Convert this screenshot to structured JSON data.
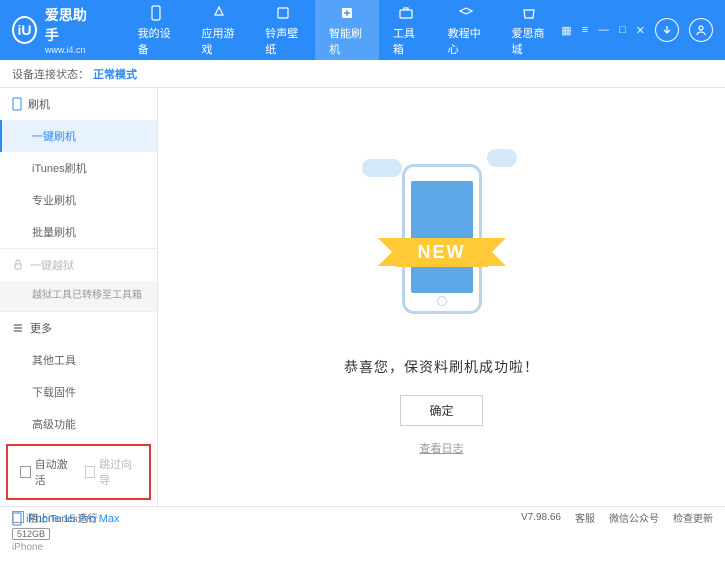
{
  "header": {
    "logo_char": "iU",
    "title": "爱思助手",
    "url": "www.i4.cn",
    "nav": [
      {
        "label": "我的设备"
      },
      {
        "label": "应用游戏"
      },
      {
        "label": "铃声壁纸"
      },
      {
        "label": "智能刷机"
      },
      {
        "label": "工具箱"
      },
      {
        "label": "教程中心"
      },
      {
        "label": "爱思商城"
      }
    ]
  },
  "status": {
    "label": "设备连接状态：",
    "mode": "正常模式"
  },
  "sidebar": {
    "section1": {
      "title": "刷机",
      "items": [
        "一键刷机",
        "iTunes刷机",
        "专业刷机",
        "批量刷机"
      ]
    },
    "section2": {
      "title": "一键越狱",
      "note": "越狱工具已转移至工具箱"
    },
    "section3": {
      "title": "更多",
      "items": [
        "其他工具",
        "下载固件",
        "高级功能"
      ]
    },
    "checkboxes": {
      "auto_activate": "自动激活",
      "skip_setup": "跳过向导"
    },
    "device": {
      "name": "iPhone 15 Pro Max",
      "storage": "512GB",
      "type": "iPhone"
    }
  },
  "main": {
    "ribbon": "NEW",
    "success": "恭喜您，保资料刷机成功啦！",
    "ok": "确定",
    "log": "查看日志"
  },
  "footer": {
    "block_itunes": "阻止iTunes运行",
    "version": "V7.98.66",
    "links": [
      "客服",
      "微信公众号",
      "检查更新"
    ]
  }
}
